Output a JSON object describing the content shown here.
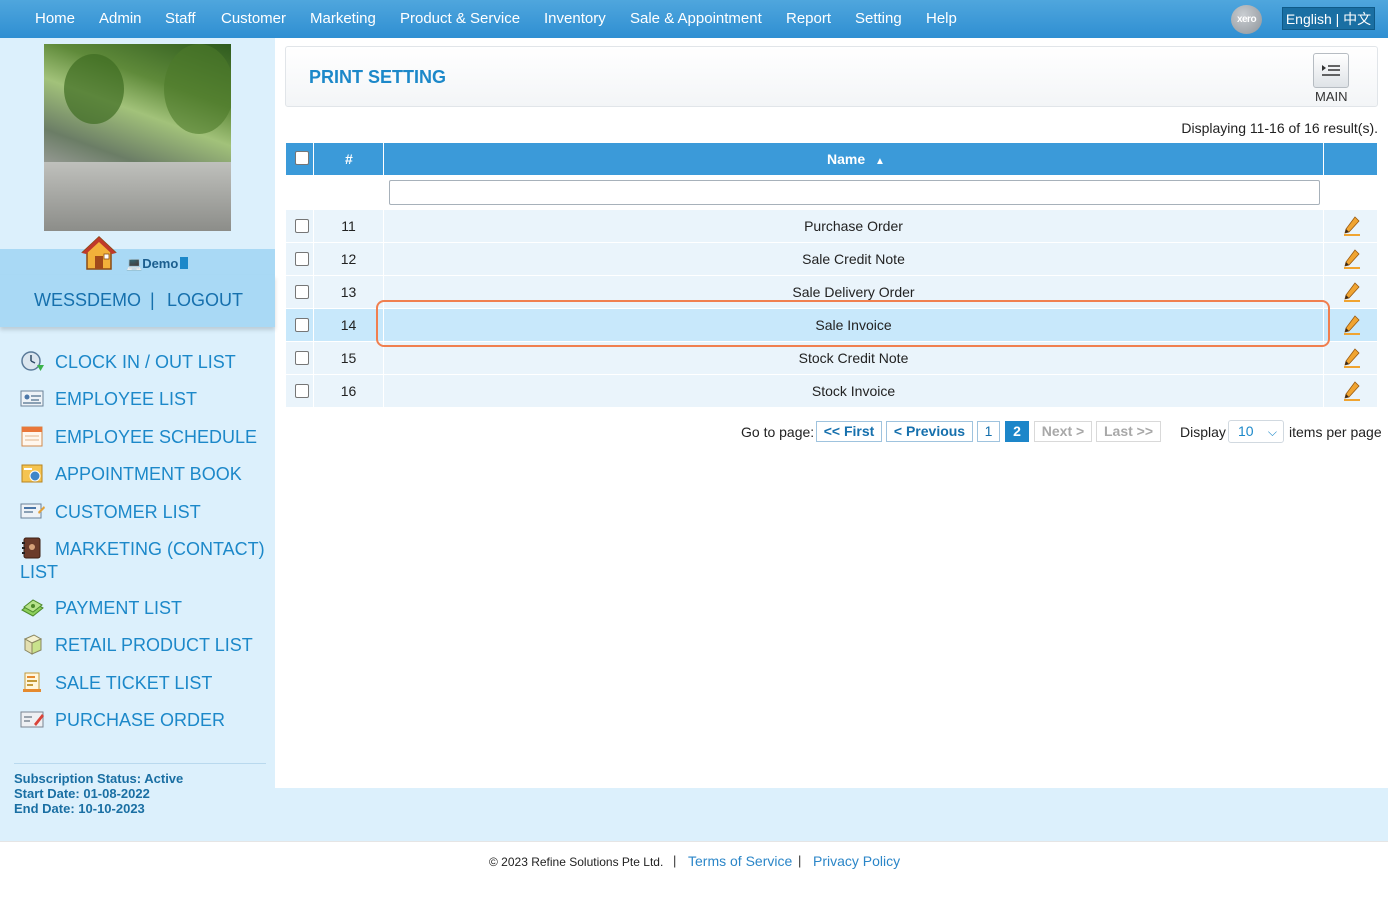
{
  "nav": {
    "items": [
      "Home",
      "Admin",
      "Staff",
      "Customer",
      "Marketing",
      "Product & Service",
      "Inventory",
      "Sale & Appointment",
      "Report",
      "Setting",
      "Help"
    ],
    "xero_label": "xero",
    "language": "English | 中文"
  },
  "sidebar": {
    "demo_label": "Demo",
    "username": "WESSDEMO",
    "logout": "LOGOUT",
    "separator": "|",
    "menu": [
      {
        "label": "CLOCK IN / OUT LIST",
        "icon": "clock-icon"
      },
      {
        "label": "EMPLOYEE LIST",
        "icon": "employee-card-icon"
      },
      {
        "label": "EMPLOYEE SCHEDULE",
        "icon": "calendar-icon"
      },
      {
        "label": "APPOINTMENT BOOK",
        "icon": "appointment-book-icon"
      },
      {
        "label": "CUSTOMER LIST",
        "icon": "customer-card-icon"
      },
      {
        "label": "MARKETING (CONTACT) LIST",
        "icon": "contact-book-icon"
      },
      {
        "label": "PAYMENT LIST",
        "icon": "money-icon"
      },
      {
        "label": "RETAIL PRODUCT LIST",
        "icon": "product-box-icon"
      },
      {
        "label": "SALE TICKET LIST",
        "icon": "receipt-icon"
      },
      {
        "label": "PURCHASE ORDER",
        "icon": "purchase-order-icon"
      }
    ],
    "subscription": {
      "status": "Subscription Status: Active",
      "start": "Start Date: 01-08-2022",
      "end": "End Date: 10-10-2023"
    }
  },
  "main": {
    "title": "PRINT SETTING",
    "main_button_label": "MAIN",
    "displaying": "Displaying 11-16 of 16 result(s).",
    "table": {
      "col_num": "#",
      "col_name": "Name",
      "sort_indicator": "▲",
      "rows": [
        {
          "num": "11",
          "name": "Purchase Order"
        },
        {
          "num": "12",
          "name": "Sale Credit Note"
        },
        {
          "num": "13",
          "name": "Sale Delivery Order"
        },
        {
          "num": "14",
          "name": "Sale Invoice"
        },
        {
          "num": "15",
          "name": "Stock Credit Note"
        },
        {
          "num": "16",
          "name": "Stock Invoice"
        }
      ]
    },
    "pager": {
      "goto": "Go to page:",
      "first": "<< First",
      "previous": "< Previous",
      "pages": [
        "1",
        "2"
      ],
      "current": "2",
      "next": "Next >",
      "last": "Last >>",
      "display": "Display",
      "per_page_value": "10",
      "items_per_page": "items per page"
    }
  },
  "footer": {
    "copyright": "© 2023 Refine Solutions Pte Ltd.",
    "terms": "Terms of Service",
    "privacy": "Privacy Policy",
    "separator": "|"
  },
  "colors": {
    "accent": "#1c88c9",
    "nav_bg": "#3b9ad9",
    "sidebar_bg": "#dcf0fc",
    "highlight": "#f07f4f"
  }
}
